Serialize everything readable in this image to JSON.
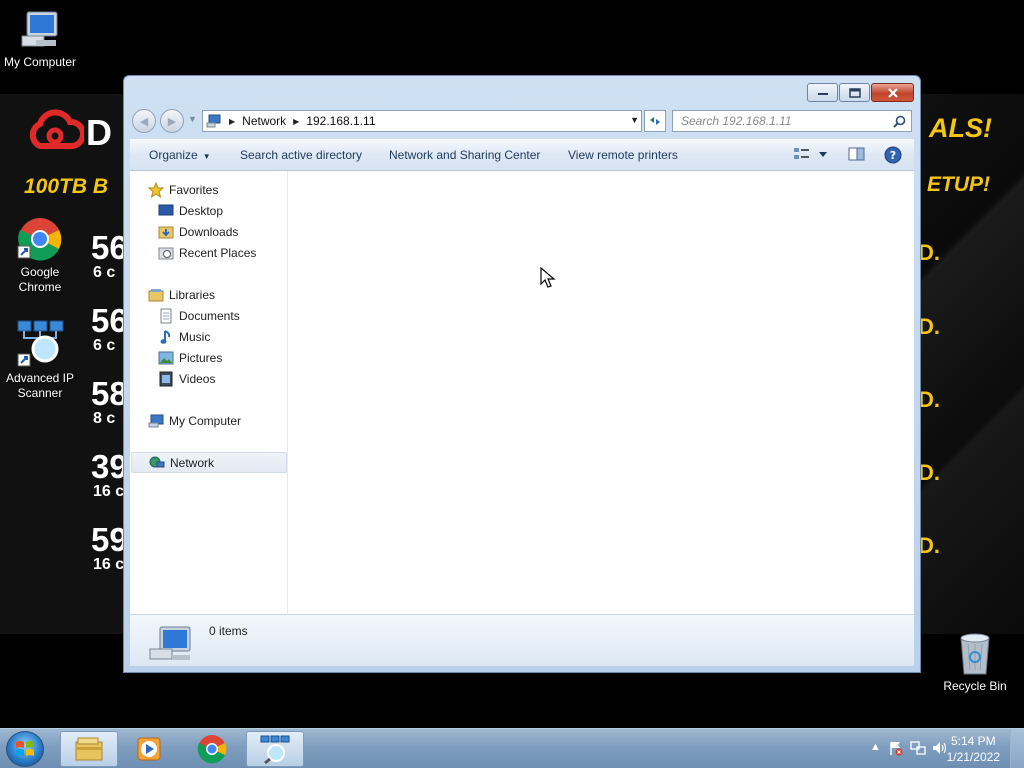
{
  "desktop": {
    "icons": [
      {
        "label": "My Computer",
        "icon": "computer-icon"
      },
      {
        "label": "Google Chrome",
        "icon": "chrome-icon"
      },
      {
        "label": "Advanced IP Scanner",
        "icon": "ip-scanner-icon"
      },
      {
        "label": "Recycle Bin",
        "icon": "recycle-bin-icon"
      }
    ],
    "wallpaper": {
      "brand": "D",
      "offer": "100TB B",
      "deals": "ALS!",
      "setup": "ETUP!",
      "rows": [
        {
          "price": "56",
          "cores": "6 c"
        },
        {
          "price": "56",
          "cores": "6 c"
        },
        {
          "price": "58",
          "cores": "8 c"
        },
        {
          "price": "39",
          "cores": "16 c"
        },
        {
          "price": "59",
          "cores": "16 c"
        }
      ],
      "accent": "#f3c614",
      "logo_color": "#e02a2a"
    }
  },
  "window": {
    "caption": {
      "minimize": "—",
      "maximize": "☐",
      "close": "✕"
    },
    "address": {
      "crumbs": [
        "Network",
        "192.168.1.11"
      ]
    },
    "search": {
      "placeholder": "Search 192.168.1.11"
    },
    "toolbar": {
      "organize": "Organize",
      "search_ad": "Search active directory",
      "network_sharing": "Network and Sharing Center",
      "remote_printers": "View remote printers"
    },
    "nav": {
      "favorites": "Favorites",
      "desktop": "Desktop",
      "downloads": "Downloads",
      "recent": "Recent Places",
      "libraries": "Libraries",
      "documents": "Documents",
      "music": "Music",
      "pictures": "Pictures",
      "videos": "Videos",
      "my_computer": "My Computer",
      "network": "Network"
    },
    "details": {
      "items": "0 items"
    }
  },
  "taskbar": {
    "apps": [
      "explorer-icon",
      "media-player-icon",
      "chrome-icon",
      "ip-scanner-icon"
    ],
    "clock": {
      "time": "5:14 PM",
      "date": "1/21/2022"
    }
  }
}
